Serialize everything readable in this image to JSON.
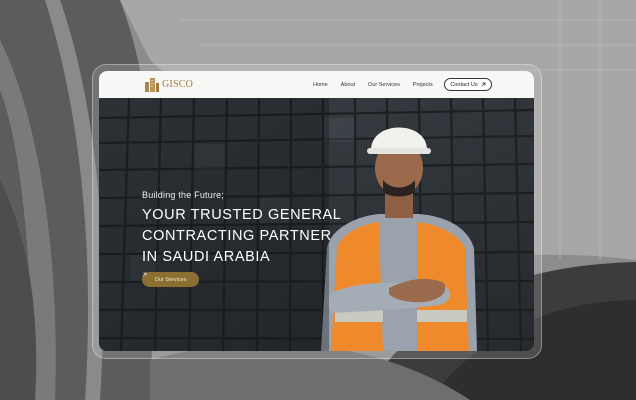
{
  "brand": {
    "name": "GISCO",
    "logo_icon": "building-icon"
  },
  "nav": {
    "links": [
      {
        "label": "Home"
      },
      {
        "label": "About"
      },
      {
        "label": "Our Services"
      },
      {
        "label": "Projects"
      }
    ],
    "contact": {
      "label": "Contact Us",
      "icon": "arrow-up-right-icon"
    }
  },
  "hero": {
    "tagline": "Building the Future;",
    "headline_lines": [
      "YOUR TRUSTED GENERAL",
      "CONTRACTING PARTNER",
      "IN SAUDI ARABIA"
    ],
    "cta": {
      "label": "Our Services",
      "icon": "arrow-up-right-icon"
    }
  },
  "colors": {
    "accent": "#8d7031",
    "brand_gold": "#9c7a3a",
    "vest_orange": "#f08a2a"
  }
}
